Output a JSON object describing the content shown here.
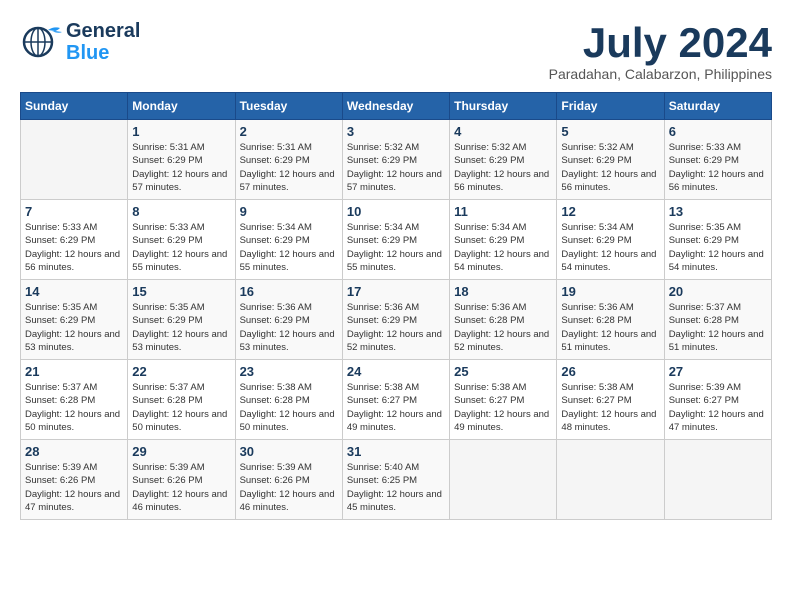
{
  "header": {
    "logo_line1": "General",
    "logo_line2": "Blue",
    "month": "July 2024",
    "location": "Paradahan, Calabarzon, Philippines"
  },
  "weekdays": [
    "Sunday",
    "Monday",
    "Tuesday",
    "Wednesday",
    "Thursday",
    "Friday",
    "Saturday"
  ],
  "weeks": [
    [
      {
        "day": "",
        "sunrise": "",
        "sunset": "",
        "daylight": ""
      },
      {
        "day": "1",
        "sunrise": "Sunrise: 5:31 AM",
        "sunset": "Sunset: 6:29 PM",
        "daylight": "Daylight: 12 hours and 57 minutes."
      },
      {
        "day": "2",
        "sunrise": "Sunrise: 5:31 AM",
        "sunset": "Sunset: 6:29 PM",
        "daylight": "Daylight: 12 hours and 57 minutes."
      },
      {
        "day": "3",
        "sunrise": "Sunrise: 5:32 AM",
        "sunset": "Sunset: 6:29 PM",
        "daylight": "Daylight: 12 hours and 57 minutes."
      },
      {
        "day": "4",
        "sunrise": "Sunrise: 5:32 AM",
        "sunset": "Sunset: 6:29 PM",
        "daylight": "Daylight: 12 hours and 56 minutes."
      },
      {
        "day": "5",
        "sunrise": "Sunrise: 5:32 AM",
        "sunset": "Sunset: 6:29 PM",
        "daylight": "Daylight: 12 hours and 56 minutes."
      },
      {
        "day": "6",
        "sunrise": "Sunrise: 5:33 AM",
        "sunset": "Sunset: 6:29 PM",
        "daylight": "Daylight: 12 hours and 56 minutes."
      }
    ],
    [
      {
        "day": "7",
        "sunrise": "Sunrise: 5:33 AM",
        "sunset": "Sunset: 6:29 PM",
        "daylight": "Daylight: 12 hours and 56 minutes."
      },
      {
        "day": "8",
        "sunrise": "Sunrise: 5:33 AM",
        "sunset": "Sunset: 6:29 PM",
        "daylight": "Daylight: 12 hours and 55 minutes."
      },
      {
        "day": "9",
        "sunrise": "Sunrise: 5:34 AM",
        "sunset": "Sunset: 6:29 PM",
        "daylight": "Daylight: 12 hours and 55 minutes."
      },
      {
        "day": "10",
        "sunrise": "Sunrise: 5:34 AM",
        "sunset": "Sunset: 6:29 PM",
        "daylight": "Daylight: 12 hours and 55 minutes."
      },
      {
        "day": "11",
        "sunrise": "Sunrise: 5:34 AM",
        "sunset": "Sunset: 6:29 PM",
        "daylight": "Daylight: 12 hours and 54 minutes."
      },
      {
        "day": "12",
        "sunrise": "Sunrise: 5:34 AM",
        "sunset": "Sunset: 6:29 PM",
        "daylight": "Daylight: 12 hours and 54 minutes."
      },
      {
        "day": "13",
        "sunrise": "Sunrise: 5:35 AM",
        "sunset": "Sunset: 6:29 PM",
        "daylight": "Daylight: 12 hours and 54 minutes."
      }
    ],
    [
      {
        "day": "14",
        "sunrise": "Sunrise: 5:35 AM",
        "sunset": "Sunset: 6:29 PM",
        "daylight": "Daylight: 12 hours and 53 minutes."
      },
      {
        "day": "15",
        "sunrise": "Sunrise: 5:35 AM",
        "sunset": "Sunset: 6:29 PM",
        "daylight": "Daylight: 12 hours and 53 minutes."
      },
      {
        "day": "16",
        "sunrise": "Sunrise: 5:36 AM",
        "sunset": "Sunset: 6:29 PM",
        "daylight": "Daylight: 12 hours and 53 minutes."
      },
      {
        "day": "17",
        "sunrise": "Sunrise: 5:36 AM",
        "sunset": "Sunset: 6:29 PM",
        "daylight": "Daylight: 12 hours and 52 minutes."
      },
      {
        "day": "18",
        "sunrise": "Sunrise: 5:36 AM",
        "sunset": "Sunset: 6:28 PM",
        "daylight": "Daylight: 12 hours and 52 minutes."
      },
      {
        "day": "19",
        "sunrise": "Sunrise: 5:36 AM",
        "sunset": "Sunset: 6:28 PM",
        "daylight": "Daylight: 12 hours and 51 minutes."
      },
      {
        "day": "20",
        "sunrise": "Sunrise: 5:37 AM",
        "sunset": "Sunset: 6:28 PM",
        "daylight": "Daylight: 12 hours and 51 minutes."
      }
    ],
    [
      {
        "day": "21",
        "sunrise": "Sunrise: 5:37 AM",
        "sunset": "Sunset: 6:28 PM",
        "daylight": "Daylight: 12 hours and 50 minutes."
      },
      {
        "day": "22",
        "sunrise": "Sunrise: 5:37 AM",
        "sunset": "Sunset: 6:28 PM",
        "daylight": "Daylight: 12 hours and 50 minutes."
      },
      {
        "day": "23",
        "sunrise": "Sunrise: 5:38 AM",
        "sunset": "Sunset: 6:28 PM",
        "daylight": "Daylight: 12 hours and 50 minutes."
      },
      {
        "day": "24",
        "sunrise": "Sunrise: 5:38 AM",
        "sunset": "Sunset: 6:27 PM",
        "daylight": "Daylight: 12 hours and 49 minutes."
      },
      {
        "day": "25",
        "sunrise": "Sunrise: 5:38 AM",
        "sunset": "Sunset: 6:27 PM",
        "daylight": "Daylight: 12 hours and 49 minutes."
      },
      {
        "day": "26",
        "sunrise": "Sunrise: 5:38 AM",
        "sunset": "Sunset: 6:27 PM",
        "daylight": "Daylight: 12 hours and 48 minutes."
      },
      {
        "day": "27",
        "sunrise": "Sunrise: 5:39 AM",
        "sunset": "Sunset: 6:27 PM",
        "daylight": "Daylight: 12 hours and 47 minutes."
      }
    ],
    [
      {
        "day": "28",
        "sunrise": "Sunrise: 5:39 AM",
        "sunset": "Sunset: 6:26 PM",
        "daylight": "Daylight: 12 hours and 47 minutes."
      },
      {
        "day": "29",
        "sunrise": "Sunrise: 5:39 AM",
        "sunset": "Sunset: 6:26 PM",
        "daylight": "Daylight: 12 hours and 46 minutes."
      },
      {
        "day": "30",
        "sunrise": "Sunrise: 5:39 AM",
        "sunset": "Sunset: 6:26 PM",
        "daylight": "Daylight: 12 hours and 46 minutes."
      },
      {
        "day": "31",
        "sunrise": "Sunrise: 5:40 AM",
        "sunset": "Sunset: 6:25 PM",
        "daylight": "Daylight: 12 hours and 45 minutes."
      },
      {
        "day": "",
        "sunrise": "",
        "sunset": "",
        "daylight": ""
      },
      {
        "day": "",
        "sunrise": "",
        "sunset": "",
        "daylight": ""
      },
      {
        "day": "",
        "sunrise": "",
        "sunset": "",
        "daylight": ""
      }
    ]
  ]
}
